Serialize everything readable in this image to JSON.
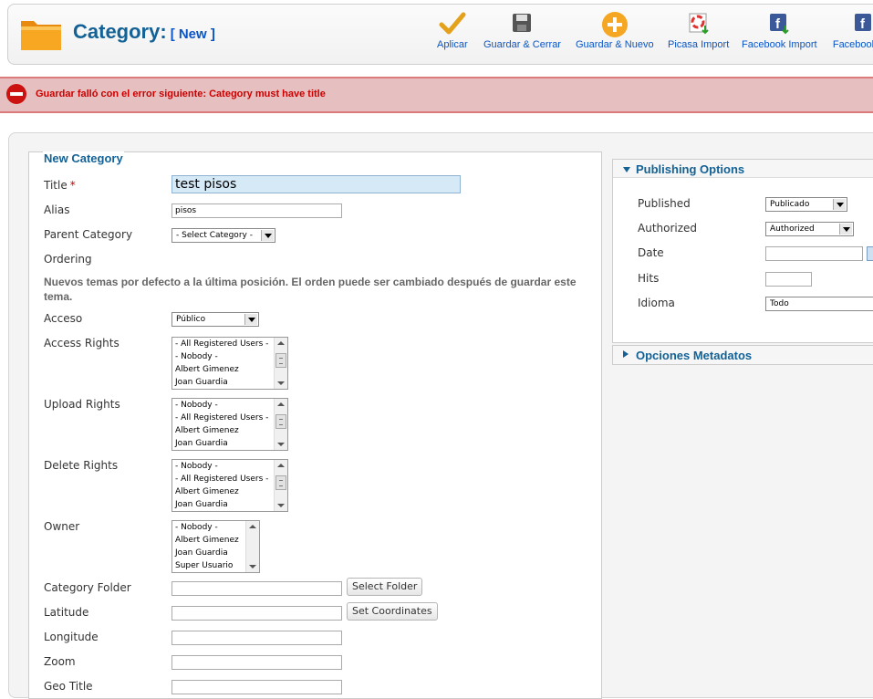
{
  "header": {
    "title": "Category:",
    "subtitle": "[ New ]",
    "buttons": [
      {
        "label": "Aplicar",
        "icon": "checkmark-icon"
      },
      {
        "label": "Guardar & Cerrar",
        "icon": "floppy-disk-icon"
      },
      {
        "label": "Guardar & Nuevo",
        "icon": "plus-circle-icon"
      },
      {
        "label": "Picasa Import",
        "icon": "picasa-import-icon"
      },
      {
        "label": "Facebook Import",
        "icon": "facebook-import-icon"
      },
      {
        "label": "Facebook",
        "icon": "facebook-icon"
      }
    ]
  },
  "error": {
    "message": "Guardar falló con el error siguiente: Category must have title",
    "icon": "error-stop-icon"
  },
  "form": {
    "legend": "New Category",
    "title_label": "Title",
    "required_mark": "*",
    "title_value": "test pisos",
    "alias_label": "Alias",
    "alias_value": "pisos",
    "parent_label": "Parent Category",
    "parent_value": "- Select Category -",
    "ordering_label": "Ordering",
    "ordering_note": "Nuevos temas por defecto a la última posición. El orden puede ser cambiado después de guardar este tema.",
    "access_label": "Acceso",
    "access_value": "Público",
    "access_rights_label": "Access Rights",
    "access_rights_items": [
      "- All Registered Users -",
      "- Nobody -",
      "Albert Gimenez",
      "Joan Guardia"
    ],
    "upload_rights_label": "Upload Rights",
    "upload_rights_items": [
      "- Nobody -",
      "- All Registered Users -",
      "Albert Gimenez",
      "Joan Guardia"
    ],
    "delete_rights_label": "Delete Rights",
    "delete_rights_items": [
      "- Nobody -",
      "- All Registered Users -",
      "Albert Gimenez",
      "Joan Guardia"
    ],
    "owner_label": "Owner",
    "owner_items": [
      "- Nobody -",
      "Albert Gimenez",
      "Joan Guardia",
      "Super Usuario"
    ],
    "folder_label": "Category Folder",
    "select_folder_button": "Select Folder",
    "latitude_label": "Latitude",
    "set_coordinates_button": "Set Coordinates",
    "longitude_label": "Longitude",
    "zoom_label": "Zoom",
    "geo_title_label": "Geo Title"
  },
  "publishing": {
    "title": "Publishing Options",
    "published_label": "Published",
    "published_value": "Publicado",
    "authorized_label": "Authorized",
    "authorized_value": "Authorized",
    "date_label": "Date",
    "hits_label": "Hits",
    "language_label": "Idioma",
    "language_value": "Todo"
  },
  "metadata": {
    "title": "Opciones Metadatos"
  }
}
